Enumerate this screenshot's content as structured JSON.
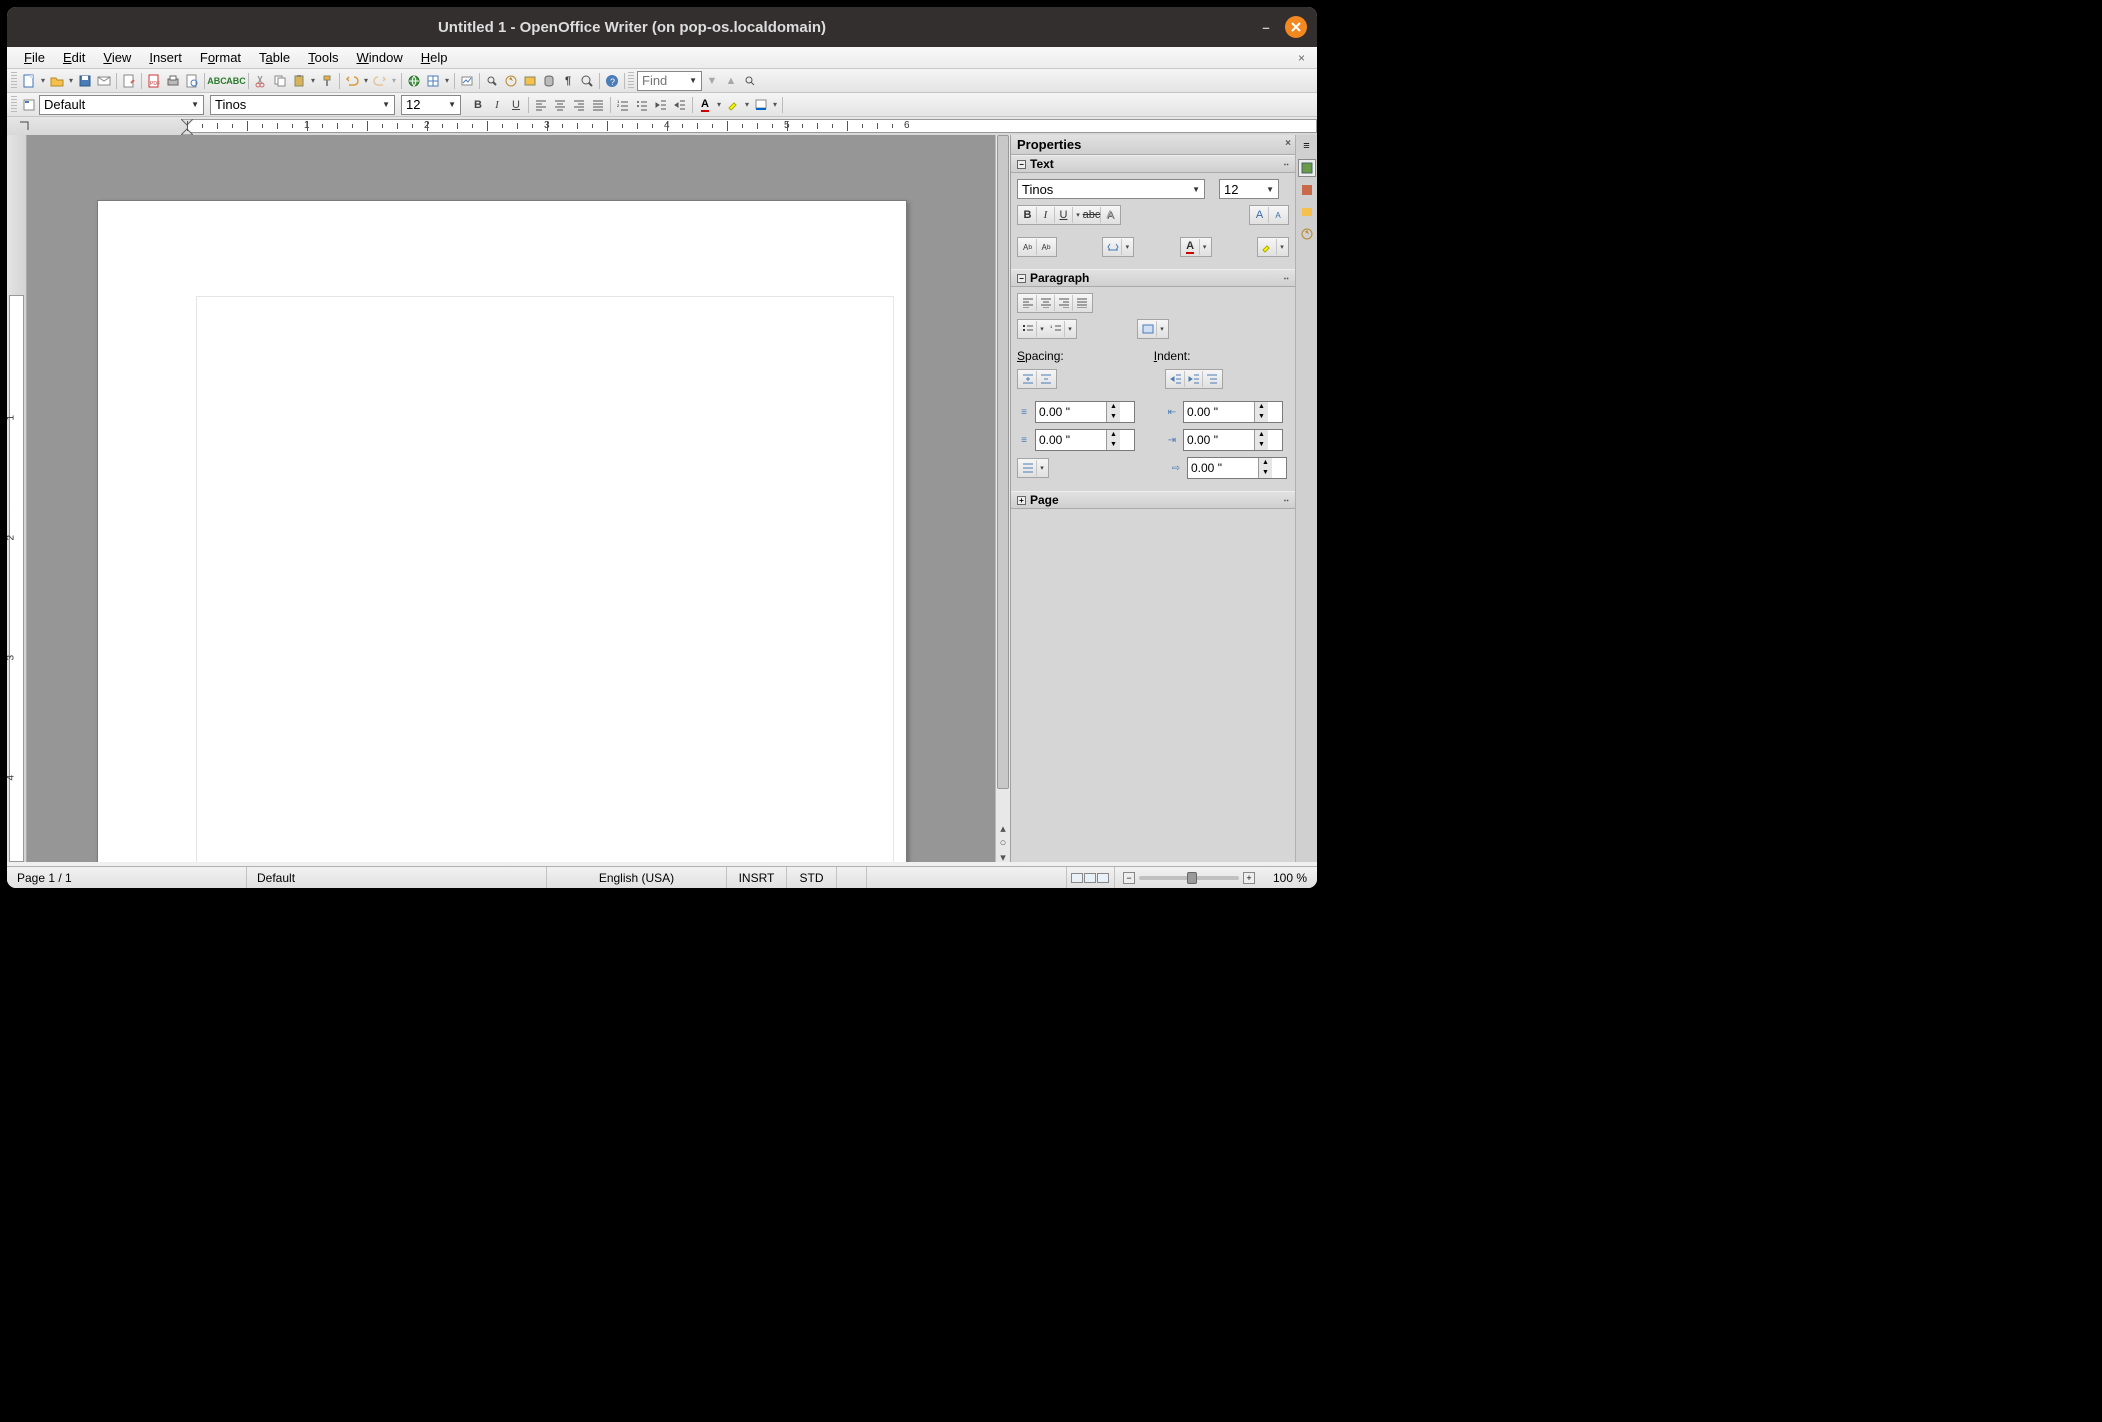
{
  "title": "Untitled 1 - OpenOffice Writer (on pop-os.localdomain)",
  "menus": {
    "file": "File",
    "edit": "Edit",
    "view": "View",
    "insert": "Insert",
    "format": "Format",
    "table": "Table",
    "tools": "Tools",
    "window": "Window",
    "help": "Help"
  },
  "toolbar2": {
    "style": "Default",
    "font": "Tinos",
    "size": "12"
  },
  "find_placeholder": "Find",
  "ruler_nums": [
    "1",
    "2",
    "3",
    "4",
    "5",
    "6"
  ],
  "vruler_nums": [
    "1",
    "2",
    "3",
    "4"
  ],
  "sidebar": {
    "title": "Properties",
    "text": {
      "label": "Text",
      "font": "Tinos",
      "size": "12"
    },
    "paragraph": {
      "label": "Paragraph",
      "spacing": "Spacing:",
      "indent": "Indent:",
      "space_above": "0.00 \"",
      "space_below": "0.00 \"",
      "indent_left": "0.00 \"",
      "indent_right": "0.00 \"",
      "indent_first": "0.00 \""
    },
    "page": {
      "label": "Page"
    }
  },
  "status": {
    "page": "Page 1 / 1",
    "style": "Default",
    "lang": "English (USA)",
    "insert": "INSRT",
    "sel": "STD",
    "zoom": "100 %"
  }
}
